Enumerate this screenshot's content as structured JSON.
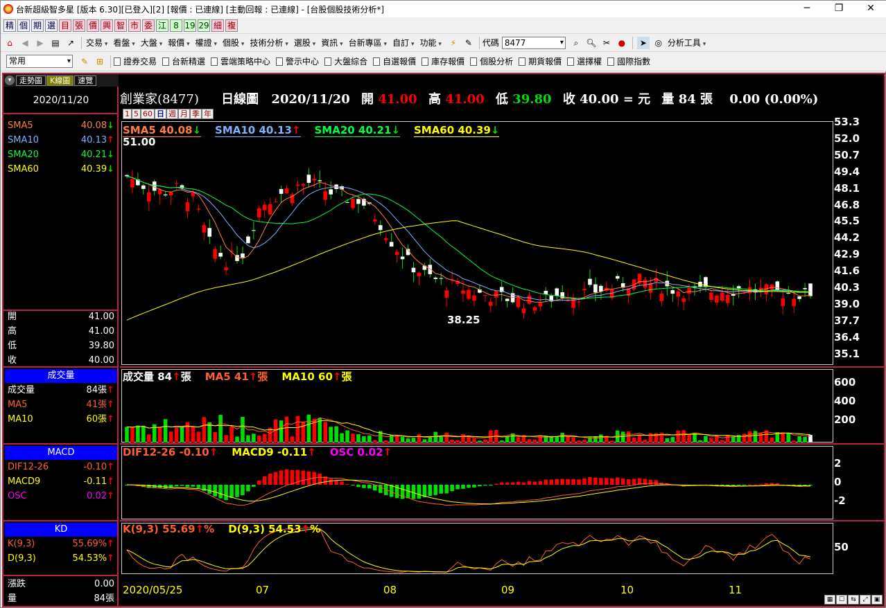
{
  "window": {
    "title": "台新超級智多星 [版本 6.30][已登入][2] [報價 : 已連線] [主動回報 : 已連線] - [台股個股技術分析*]",
    "minimize": "─",
    "restore": "❐",
    "close": "✕"
  },
  "quick_buttons": [
    "精",
    "個",
    "期",
    "選",
    "目",
    "張",
    "價",
    "興",
    "智",
    "市",
    "委",
    "江",
    "8",
    "19",
    "29",
    "細",
    "複"
  ],
  "toolbar": {
    "menus": [
      "交易",
      "看盤",
      "大盤",
      "報價",
      "權證",
      "個股",
      "技術分析",
      "選股",
      "資訊",
      "台新專區",
      "自訂",
      "功能"
    ],
    "code_label": "代碼",
    "code_value": "8477",
    "analysis_tools": "分析工具"
  },
  "linkbar": {
    "select_value": "常用",
    "links": [
      "證券交易",
      "台新精選",
      "雲端策略中心",
      "警示中心",
      "大盤綜合",
      "自選報價",
      "庫存報價",
      "個股分析",
      "期貨報價",
      "選擇權",
      "國際指數"
    ]
  },
  "tabs": [
    "走勢圖",
    "K線圖",
    "速覽"
  ],
  "left": {
    "date": "2020/11/20",
    "sma": [
      {
        "label": "SMA5",
        "value": "40.08",
        "dir": "down",
        "color": "#ff8040"
      },
      {
        "label": "SMA10",
        "value": "40.13",
        "dir": "up",
        "color": "#7fb2ff"
      },
      {
        "label": "SMA20",
        "value": "40.21",
        "dir": "down",
        "color": "#00ff40"
      },
      {
        "label": "SMA60",
        "value": "40.39",
        "dir": "down",
        "color": "#ffff00"
      }
    ],
    "ohlc": [
      {
        "label": "開",
        "value": "41.00"
      },
      {
        "label": "高",
        "value": "41.00"
      },
      {
        "label": "低",
        "value": "39.80"
      },
      {
        "label": "收",
        "value": "40.00"
      }
    ],
    "volume_head": "成交量",
    "volume": [
      {
        "label": "成交量",
        "value": "84張",
        "color": "#ffffff"
      },
      {
        "label": "MA5",
        "value": "41張",
        "color": "#ff6030"
      },
      {
        "label": "MA10",
        "value": "60張",
        "color": "#ffff00"
      }
    ],
    "macd_head": "MACD",
    "macd": [
      {
        "label": "DIF12-26",
        "value": "-0.10",
        "color": "#ff6030"
      },
      {
        "label": "MACD9",
        "value": "-0.11",
        "color": "#ffff00"
      },
      {
        "label": "OSC",
        "value": "0.02",
        "color": "#ff00ff"
      }
    ],
    "kd_head": "KD",
    "kd": [
      {
        "label": "K(9,3)",
        "value": "55.69%",
        "color": "#ff6030"
      },
      {
        "label": "D(9,3)",
        "value": "54.53%",
        "color": "#ffff00"
      }
    ],
    "change_label": "漲跌",
    "change_value": "0.00",
    "vol_label": "量",
    "vol_value": "84張"
  },
  "stock": {
    "name": "創業家(8477)",
    "period": "日線圖",
    "date": "2020/11/20",
    "open_label": "開",
    "open": "41.00",
    "high_label": "高",
    "high": "41.00",
    "low_label": "低",
    "low": "39.80",
    "close_label": "收",
    "close": "40.00 = 元",
    "vol_label": "量",
    "vol": "84 張",
    "change": "0.00 (0.00%)"
  },
  "periods": [
    "1",
    "5",
    "60",
    "日",
    "週",
    "月",
    "季",
    "年"
  ],
  "legend_price": [
    {
      "text": "SMA5 40.08",
      "arrow": "down",
      "color": "#ff8040"
    },
    {
      "text": "SMA10 40.13",
      "arrow": "up",
      "color": "#7fb2ff"
    },
    {
      "text": "SMA20 40.21",
      "arrow": "down",
      "color": "#00ff40"
    },
    {
      "text": "SMA60 40.39",
      "arrow": "down",
      "color": "#ffff00"
    }
  ],
  "legend_volume": [
    {
      "text": "成交量 84",
      "suffix": "張",
      "color": "#ffffff"
    },
    {
      "text": "MA5 41",
      "suffix": "張",
      "color": "#ff6030"
    },
    {
      "text": "MA10 60",
      "suffix": "張",
      "color": "#ffff00"
    }
  ],
  "legend_macd": [
    {
      "text": "DIF12-26 -0.10",
      "color": "#ff6030"
    },
    {
      "text": "MACD9 -0.11",
      "color": "#ffff00"
    },
    {
      "text": "OSC 0.02",
      "color": "#ff00ff"
    }
  ],
  "legend_kd": [
    {
      "text": "K(9,3) 55.69",
      "suffix": "%",
      "color": "#ff6030"
    },
    {
      "text": "D(9,3) 54.53",
      "suffix": "%",
      "color": "#ffff00"
    }
  ],
  "annotations": {
    "max": "51.00",
    "min": "38.25"
  },
  "price_axis": [
    "53.3",
    "52.0",
    "50.7",
    "49.4",
    "48.1",
    "46.8",
    "45.5",
    "44.2",
    "42.9",
    "41.6",
    "40.3",
    "39.0",
    "37.7",
    "36.4",
    "35.1"
  ],
  "volume_axis": [
    "600",
    "400",
    "200"
  ],
  "macd_axis": [
    "2",
    "0",
    "-2"
  ],
  "kd_axis": [
    "50"
  ],
  "date_axis": [
    "2020/05/25",
    "07",
    "08",
    "09",
    "10",
    "11"
  ],
  "colors": {
    "up": "#ff0000",
    "down": "#00e000",
    "frame": "#c02040"
  },
  "chart_data": {
    "type": "candlestick",
    "title": "創業家(8477) 日線圖",
    "x_range": [
      "2020/05/25",
      "2020/11/20"
    ],
    "y_range": [
      35.1,
      53.3
    ],
    "last": {
      "date": "2020/11/20",
      "open": 41.0,
      "high": 41.0,
      "low": 39.8,
      "close": 40.0,
      "volume": 84
    },
    "price_max": 51.0,
    "price_min": 38.25,
    "sma": {
      "SMA5": 40.08,
      "SMA10": 40.13,
      "SMA20": 40.21,
      "SMA60": 40.39
    },
    "trend_close": [
      49.5,
      48.8,
      48.2,
      48.5,
      47.6,
      44.0,
      42.8,
      43.5,
      47.2,
      48.0,
      48.6,
      49.0,
      48.3,
      47.8,
      47.6,
      46.2,
      44.1,
      42.5,
      41.6,
      41.0,
      40.7,
      40.2,
      40.0,
      39.8,
      39.5,
      39.6,
      40.2,
      40.1,
      40.4,
      40.6,
      41.1,
      41.2,
      40.8,
      40.5,
      40.3,
      40.4,
      40.5,
      40.6,
      40.4,
      40.3,
      40.2,
      40.0
    ]
  }
}
